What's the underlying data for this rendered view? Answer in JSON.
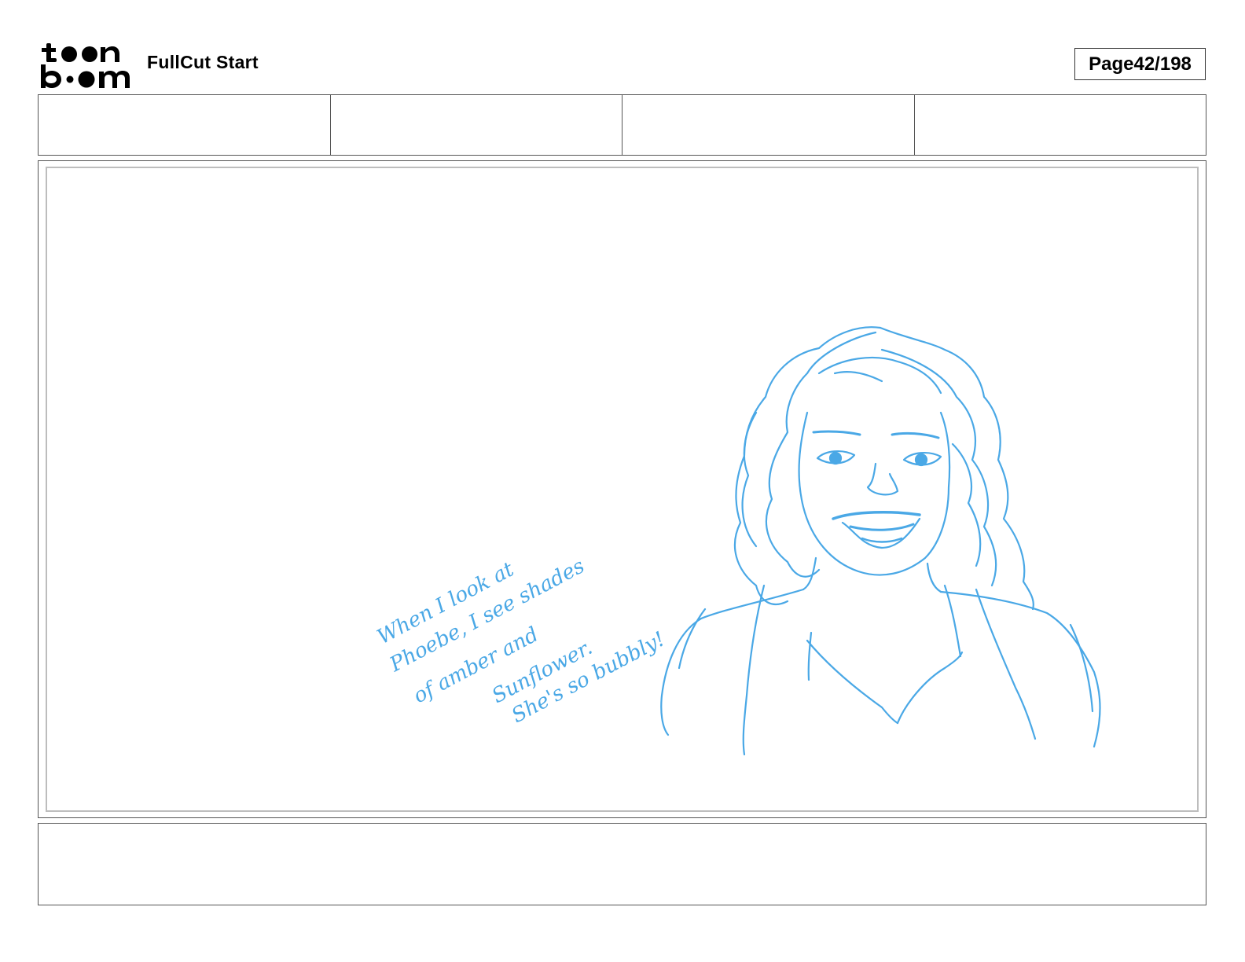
{
  "header": {
    "logo_text": "toon boom",
    "project_title": "FullCut Start",
    "page_label": "Page",
    "page_number": "42/198"
  },
  "info_fields": [
    {
      "label": "",
      "value": ""
    },
    {
      "label": "",
      "value": ""
    },
    {
      "label": "",
      "value": ""
    },
    {
      "label": "",
      "value": ""
    }
  ],
  "panel": {
    "sketch_color": "#4aa8e6",
    "handwritten_note": "When I look at Phoebe, I see shades of amber and Sunflower. She's so bubbly!"
  },
  "notes": {
    "text": ""
  }
}
